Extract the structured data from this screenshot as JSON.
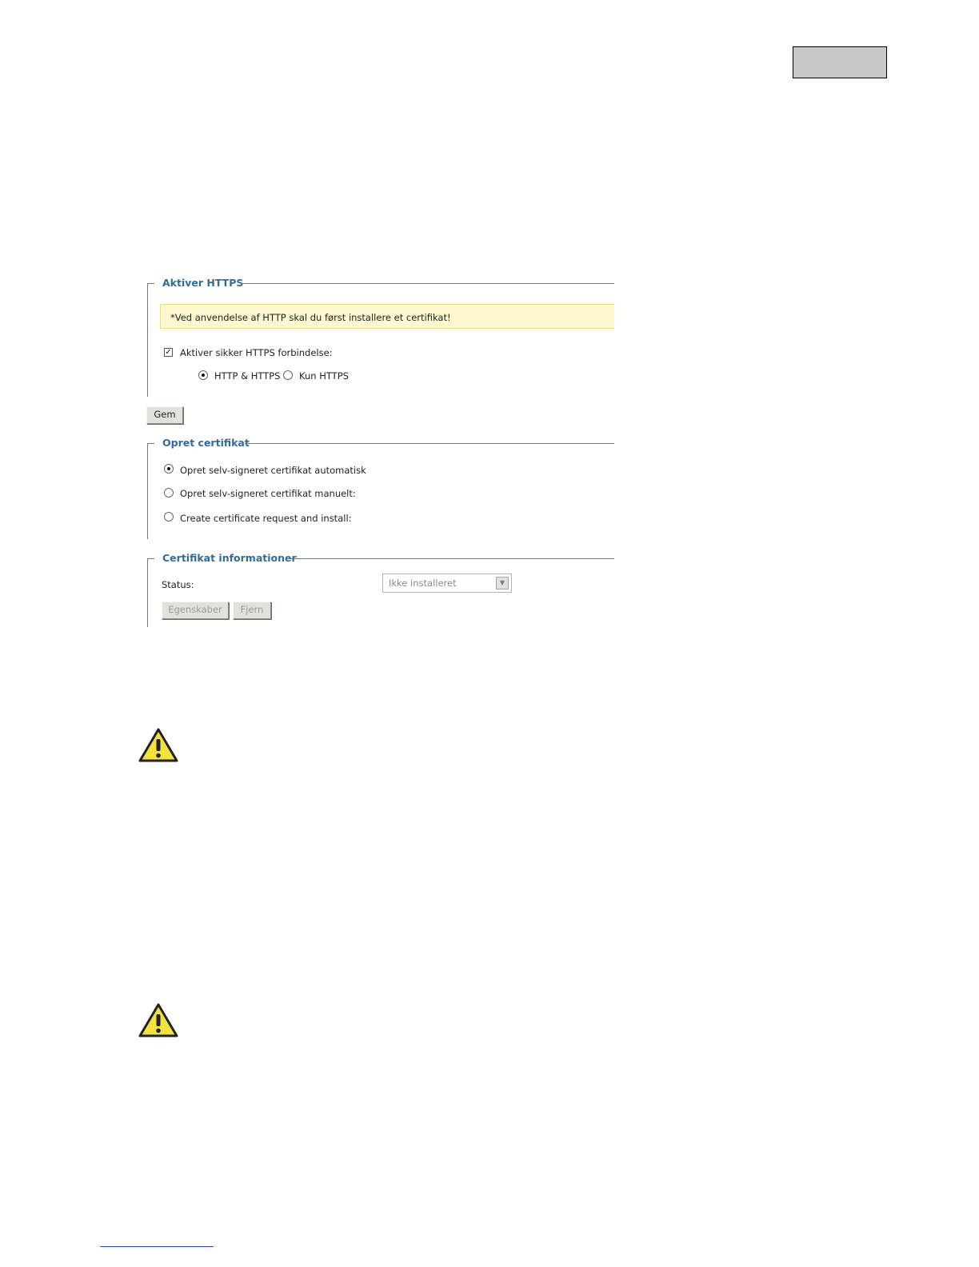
{
  "https_section": {
    "legend": "Aktiver HTTPS",
    "notice": "*Ved anvendelse af HTTP skal du først installere et certifikat!",
    "enable_label": "Aktiver sikker HTTPS forbindelse:",
    "enable_checked": true,
    "mode_options": [
      {
        "label": "HTTP & HTTPS",
        "selected": true
      },
      {
        "label": "Kun HTTPS",
        "selected": false
      }
    ],
    "save_label": "Gem"
  },
  "cert_create_section": {
    "legend": "Opret certifikat",
    "options": [
      {
        "label": "Opret selv-signeret certifikat automatisk",
        "selected": true
      },
      {
        "label": "Opret selv-signeret certifikat manuelt:",
        "selected": false
      },
      {
        "label": "Create certificate request and install:",
        "selected": false
      }
    ]
  },
  "cert_info_section": {
    "legend": "Certifikat informationer",
    "status_label": "Status:",
    "status_value": "Ikke installeret",
    "properties_label": "Egenskaber",
    "remove_label": "Fjern"
  },
  "icons": {
    "warning": "warning-triangle-icon",
    "accent_color": "#2f6d9f",
    "warning_color": "#f3e33a"
  }
}
